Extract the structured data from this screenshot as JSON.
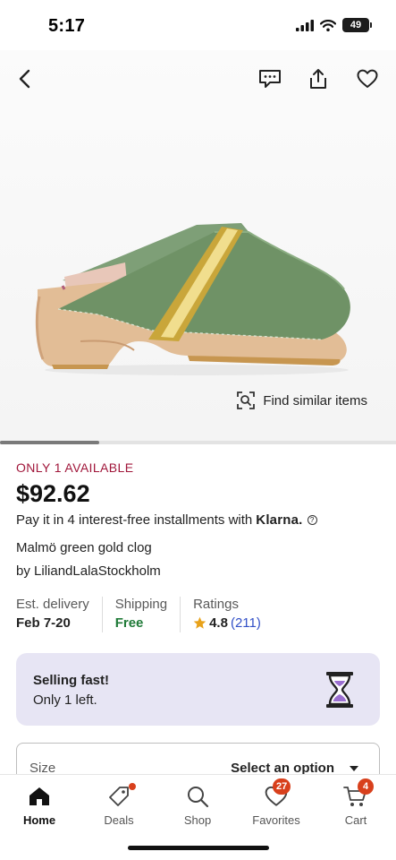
{
  "status_bar": {
    "time": "5:17",
    "battery_level": "49"
  },
  "product": {
    "availability": "ONLY 1 AVAILABLE",
    "price": "$92.62",
    "installments_text": "Pay it in 4 interest-free installments with",
    "klarna_label": "Klarna.",
    "title": "Malmö green gold clog",
    "seller_prefix": "by",
    "seller_name": "LiliandLalaStockholm"
  },
  "hero": {
    "find_similar_label": "Find similar items",
    "carousel_progress": 0.25
  },
  "stats": {
    "delivery_label": "Est. delivery",
    "delivery_value": "Feb 7-20",
    "shipping_label": "Shipping",
    "shipping_value": "Free",
    "ratings_label": "Ratings",
    "rating_value": "4.8",
    "rating_count": "(211)"
  },
  "selling_fast": {
    "title": "Selling fast!",
    "subtitle": "Only 1 left."
  },
  "size_select": {
    "label": "Size",
    "value": "Select an option"
  },
  "tabs": [
    {
      "label": "Home",
      "icon": "home-icon"
    },
    {
      "label": "Deals",
      "icon": "tag-icon"
    },
    {
      "label": "Shop",
      "icon": "search-icon"
    },
    {
      "label": "Favorites",
      "icon": "heart-icon",
      "badge": "27"
    },
    {
      "label": "Cart",
      "icon": "cart-icon",
      "badge": "4"
    }
  ],
  "colors": {
    "availability": "#a0163a",
    "badge": "#d8401c",
    "free_shipping": "#1f7a37",
    "star": "#e8a21a",
    "rating_link": "#3250c7",
    "selling_fast_bg": "#e7e5f4"
  }
}
